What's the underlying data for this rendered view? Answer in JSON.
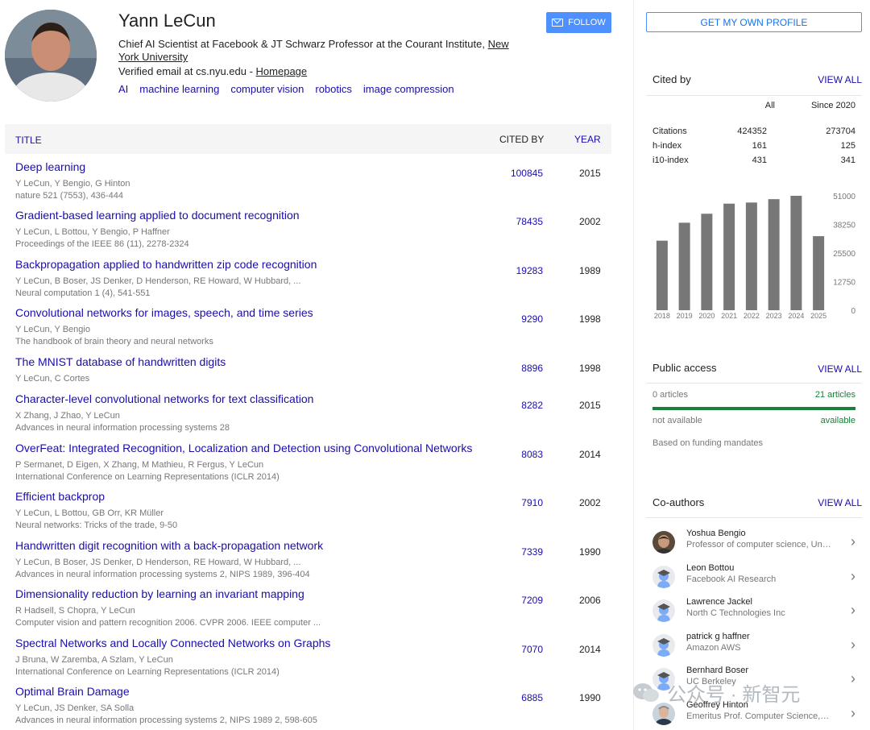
{
  "profile": {
    "name": "Yann LeCun",
    "affiliation_prefix": "Chief AI Scientist at Facebook & JT Schwarz Professor at the Courant Institute, ",
    "affiliation_link": "New York University",
    "email_prefix": "Verified email at cs.nyu.edu - ",
    "homepage_link": "Homepage",
    "interests": [
      "AI",
      "machine learning",
      "computer vision",
      "robotics",
      "image compression"
    ],
    "follow_label": "FOLLOW"
  },
  "table": {
    "header": {
      "title": "TITLE",
      "cited_by": "CITED BY",
      "year": "YEAR"
    },
    "rows": [
      {
        "title": "Deep learning",
        "authors": "Y LeCun, Y Bengio, G Hinton",
        "venue": "nature 521 (7553), 436-444",
        "cited": "100845",
        "year": "2015"
      },
      {
        "title": "Gradient-based learning applied to document recognition",
        "authors": "Y LeCun, L Bottou, Y Bengio, P Haffner",
        "venue": "Proceedings of the IEEE 86 (11), 2278-2324",
        "cited": "78435",
        "year": "2002"
      },
      {
        "title": "Backpropagation applied to handwritten zip code recognition",
        "authors": "Y LeCun, B Boser, JS Denker, D Henderson, RE Howard, W Hubbard, ...",
        "venue": "Neural computation 1 (4), 541-551",
        "cited": "19283",
        "year": "1989"
      },
      {
        "title": "Convolutional networks for images, speech, and time series",
        "authors": "Y LeCun, Y Bengio",
        "venue": "The handbook of brain theory and neural networks",
        "cited": "9290",
        "year": "1998"
      },
      {
        "title": "The MNIST database of handwritten digits",
        "authors": "Y LeCun, C Cortes",
        "venue": "",
        "cited": "8896",
        "year": "1998"
      },
      {
        "title": "Character-level convolutional networks for text classification",
        "authors": "X Zhang, J Zhao, Y LeCun",
        "venue": "Advances in neural information processing systems 28",
        "cited": "8282",
        "year": "2015"
      },
      {
        "title": "OverFeat: Integrated Recognition, Localization and Detection using Convolutional Networks",
        "authors": "P Sermanet, D Eigen, X Zhang, M Mathieu, R Fergus, Y LeCun",
        "venue": "International Conference on Learning Representations (ICLR 2014)",
        "cited": "8083",
        "year": "2014"
      },
      {
        "title": "Efficient backprop",
        "authors": "Y LeCun, L Bottou, GB Orr, KR Müller",
        "venue": "Neural networks: Tricks of the trade, 9-50",
        "cited": "7910",
        "year": "2002"
      },
      {
        "title": "Handwritten digit recognition with a back-propagation network",
        "authors": "Y LeCun, B Boser, JS Denker, D Henderson, RE Howard, W Hubbard, ...",
        "venue": "Advances in neural information processing systems 2, NIPS 1989, 396-404",
        "cited": "7339",
        "year": "1990"
      },
      {
        "title": "Dimensionality reduction by learning an invariant mapping",
        "authors": "R Hadsell, S Chopra, Y LeCun",
        "venue": "Computer vision and pattern recognition 2006. CVPR 2006. IEEE computer ...",
        "cited": "7209",
        "year": "2006"
      },
      {
        "title": "Spectral Networks and Locally Connected Networks on Graphs",
        "authors": "J Bruna, W Zaremba, A Szlam, Y LeCun",
        "venue": "International Conference on Learning Representations (ICLR 2014)",
        "cited": "7070",
        "year": "2014"
      },
      {
        "title": "Optimal Brain Damage",
        "authors": "Y LeCun, JS Denker, SA Solla",
        "venue": "Advances in neural information processing systems 2, NIPS 1989 2, 598-605",
        "cited": "6885",
        "year": "1990"
      }
    ]
  },
  "sidebar": {
    "own_profile_label": "GET MY OWN PROFILE",
    "cited_by": {
      "title": "Cited by",
      "view_all": "VIEW ALL",
      "col_all": "All",
      "col_since": "Since 2020",
      "rows": [
        {
          "label": "Citations",
          "all": "424352",
          "since": "273704"
        },
        {
          "label": "h-index",
          "all": "161",
          "since": "125"
        },
        {
          "label": "i10-index",
          "all": "431",
          "since": "341"
        }
      ]
    },
    "public_access": {
      "title": "Public access",
      "view_all": "VIEW ALL",
      "left_count": "0 articles",
      "right_count": "21 articles",
      "left_label": "not available",
      "right_label": "available",
      "footnote": "Based on funding mandates",
      "available_fraction": 1.0,
      "colors": {
        "available": "#188038"
      }
    },
    "coauthors": {
      "title": "Co-authors",
      "view_all": "VIEW ALL",
      "items": [
        {
          "name": "Yoshua Bengio",
          "affiliation": "Professor of computer science, University of Montreal",
          "avatar": "photo"
        },
        {
          "name": "Leon Bottou",
          "affiliation": "Facebook AI Research",
          "avatar": "placeholder-graduate-icon"
        },
        {
          "name": "Lawrence Jackel",
          "affiliation": "North C Technologies Inc",
          "avatar": "placeholder-graduate-icon"
        },
        {
          "name": "patrick g haffner",
          "affiliation": "Amazon AWS",
          "avatar": "placeholder-graduate-icon"
        },
        {
          "name": "Bernhard Boser",
          "affiliation": "UC Berkeley",
          "avatar": "placeholder-graduate-icon"
        },
        {
          "name": "Geoffrey Hinton",
          "affiliation": "Emeritus Prof. Computer Science, University of Toronto",
          "avatar": "photo"
        }
      ]
    }
  },
  "chart_data": {
    "type": "bar",
    "categories": [
      "2018",
      "2019",
      "2020",
      "2021",
      "2022",
      "2023",
      "2024",
      "2025"
    ],
    "values": [
      31000,
      39000,
      43000,
      47500,
      48000,
      49500,
      51000,
      33000
    ],
    "yticks": [
      "51000",
      "38250",
      "25500",
      "12750",
      "0"
    ],
    "ylim": [
      0,
      51000
    ],
    "color": "#777777",
    "title": "",
    "xlabel": "",
    "ylabel": ""
  },
  "watermark": {
    "text": "公众号 · 新智元"
  },
  "colors": {
    "link": "#1a0dab",
    "follow": "#4d90fe",
    "muted": "#777777"
  }
}
